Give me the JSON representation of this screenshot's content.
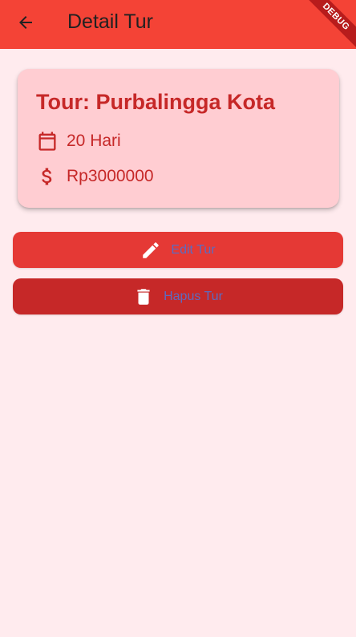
{
  "appbar": {
    "title": "Detail Tur",
    "back_icon": "arrow-back-icon",
    "debug_label": "DEBUG"
  },
  "tour": {
    "title": "Tour: Purbalingga Kota",
    "duration": "20 Hari",
    "duration_icon": "calendar-icon",
    "price": "Rp3000000",
    "price_icon": "dollar-icon"
  },
  "actions": {
    "edit_label": "Edit Tur",
    "edit_icon": "pencil-icon",
    "delete_label": "Hapus Tur",
    "delete_icon": "trash-icon"
  },
  "colors": {
    "appbar": "#f44336",
    "background": "#ffebee",
    "card": "#ffcdd2",
    "accent_text": "#c62828",
    "edit_button": "#e53935",
    "delete_button": "#c62828",
    "button_text": "#5c6bc0"
  }
}
